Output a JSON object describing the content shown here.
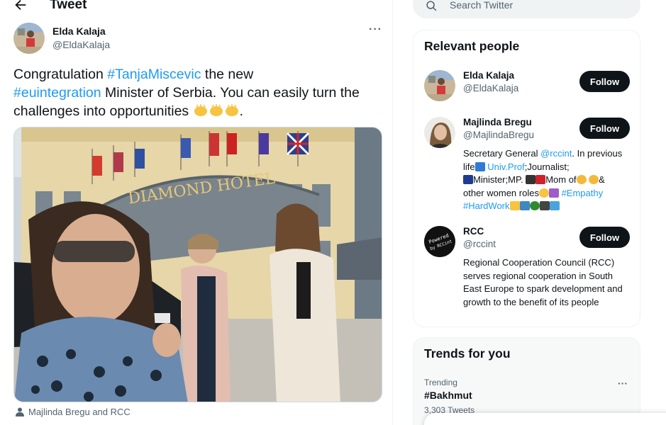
{
  "header": {
    "title": "Tweet",
    "back_icon": "arrow-left-icon"
  },
  "tweet": {
    "author_name": "Elda Kalaja",
    "author_handle": "@EldaKalaja",
    "more_icon": "more-horizontal-icon",
    "text": {
      "part1": "Congratulation ",
      "tag1": "#TanjaMiscevic",
      "part2": "  the new",
      "tag2": "#euintegration",
      "part3": " Minister of Serbia. You can easily turn the challenges into opportunities ",
      "part4": "."
    },
    "photo_sign": "DIAMOND HOTEL",
    "tagged_people": "Majlinda Bregu and RCC"
  },
  "search": {
    "placeholder": "Search Twitter",
    "icon": "search-icon"
  },
  "relevant_people": {
    "title": "Relevant people",
    "follow_label": "Follow",
    "people": [
      {
        "name": "Elda Kalaja",
        "handle": "@EldaKalaja"
      },
      {
        "name": "Majlinda Bregu",
        "handle": "@MajlindaBregu",
        "bio": {
          "a": "Secretary General ",
          "mention": "@rccint",
          "b": ". In previous life",
          "link": "Univ.Prof",
          "c": ";Journalist;",
          "d": "Minister;MP.",
          "e": "Mom of",
          "f": "&",
          "g": "other women roles",
          "tag1": "#Empathy",
          "tag2": "#HardWork"
        }
      },
      {
        "name": "RCC",
        "handle": "@rccint",
        "avatar_text_top": "Powered",
        "avatar_text_bottom": "by RCCint",
        "bio": "Regional Cooperation Council (RCC) serves regional cooperation in South East Europe to spark development and growth to the benefit of its people"
      }
    ]
  },
  "trends": {
    "title": "Trends for you",
    "items": [
      {
        "meta": "Trending",
        "name": "#Bakhmut",
        "count": "3,303 Tweets"
      }
    ]
  },
  "colors": {
    "accent": "#1d9bf0",
    "button": "#0f1419",
    "muted": "#536471"
  }
}
